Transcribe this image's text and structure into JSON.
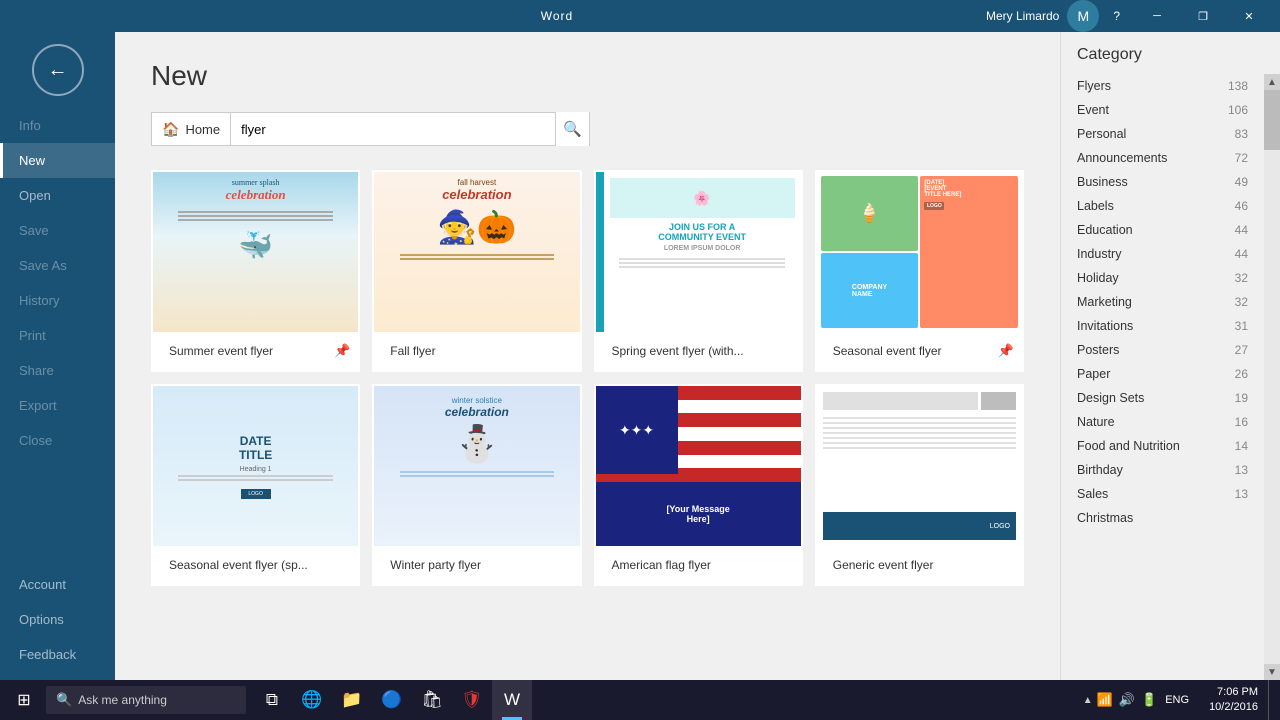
{
  "titlebar": {
    "app": "Word",
    "user": "Mery Limardo",
    "help": "?",
    "minimize": "─",
    "restore": "❐",
    "close": "✕"
  },
  "sidebar": {
    "back_label": "←",
    "items": [
      {
        "id": "info",
        "label": "Info",
        "state": "disabled"
      },
      {
        "id": "new",
        "label": "New",
        "state": "active"
      },
      {
        "id": "open",
        "label": "Open",
        "state": "normal"
      },
      {
        "id": "save",
        "label": "Save",
        "state": "disabled"
      },
      {
        "id": "save-as",
        "label": "Save As",
        "state": "disabled"
      },
      {
        "id": "history",
        "label": "History",
        "state": "disabled"
      },
      {
        "id": "print",
        "label": "Print",
        "state": "disabled"
      },
      {
        "id": "share",
        "label": "Share",
        "state": "disabled"
      },
      {
        "id": "export",
        "label": "Export",
        "state": "disabled"
      },
      {
        "id": "close",
        "label": "Close",
        "state": "disabled"
      }
    ],
    "bottom_items": [
      {
        "id": "account",
        "label": "Account",
        "state": "normal"
      },
      {
        "id": "options",
        "label": "Options",
        "state": "normal"
      },
      {
        "id": "feedback",
        "label": "Feedback",
        "state": "normal"
      }
    ]
  },
  "main": {
    "page_title": "New",
    "search": {
      "home_label": "Home",
      "placeholder": "flyer",
      "value": "flyer",
      "search_btn_label": "🔍"
    }
  },
  "templates": [
    {
      "id": "summer-event",
      "label": "Summer event flyer",
      "type": "summer"
    },
    {
      "id": "fall-flyer",
      "label": "Fall flyer",
      "type": "fall"
    },
    {
      "id": "spring-event",
      "label": "Spring event flyer (with...",
      "type": "spring"
    },
    {
      "id": "seasonal-event",
      "label": "Seasonal event flyer",
      "type": "seasonal"
    },
    {
      "id": "seasonal-sp",
      "label": "Seasonal event flyer (sp...",
      "type": "seasonal2"
    },
    {
      "id": "winter-party",
      "label": "Winter party flyer",
      "type": "winter"
    },
    {
      "id": "american-flag",
      "label": "American flag flyer",
      "type": "flag"
    },
    {
      "id": "generic-event",
      "label": "Generic event flyer",
      "type": "generic"
    }
  ],
  "categories": {
    "header": "Category",
    "items": [
      {
        "name": "Flyers",
        "count": 138
      },
      {
        "name": "Event",
        "count": 106
      },
      {
        "name": "Personal",
        "count": 83
      },
      {
        "name": "Announcements",
        "count": 72
      },
      {
        "name": "Business",
        "count": 49
      },
      {
        "name": "Labels",
        "count": 46
      },
      {
        "name": "Education",
        "count": 44
      },
      {
        "name": "Industry",
        "count": 44
      },
      {
        "name": "Holiday",
        "count": 32
      },
      {
        "name": "Marketing",
        "count": 32
      },
      {
        "name": "Invitations",
        "count": 31
      },
      {
        "name": "Posters",
        "count": 27
      },
      {
        "name": "Paper",
        "count": 26
      },
      {
        "name": "Design Sets",
        "count": 19
      },
      {
        "name": "Nature",
        "count": 16
      },
      {
        "name": "Food and Nutrition",
        "count": 14
      },
      {
        "name": "Birthday",
        "count": 13
      },
      {
        "name": "Sales",
        "count": 13
      },
      {
        "name": "Christmas",
        "count": ""
      }
    ]
  },
  "taskbar": {
    "search_placeholder": "Ask me anything",
    "time": "7:06 PM",
    "date": "10/2/2016",
    "lang": "ENG"
  }
}
